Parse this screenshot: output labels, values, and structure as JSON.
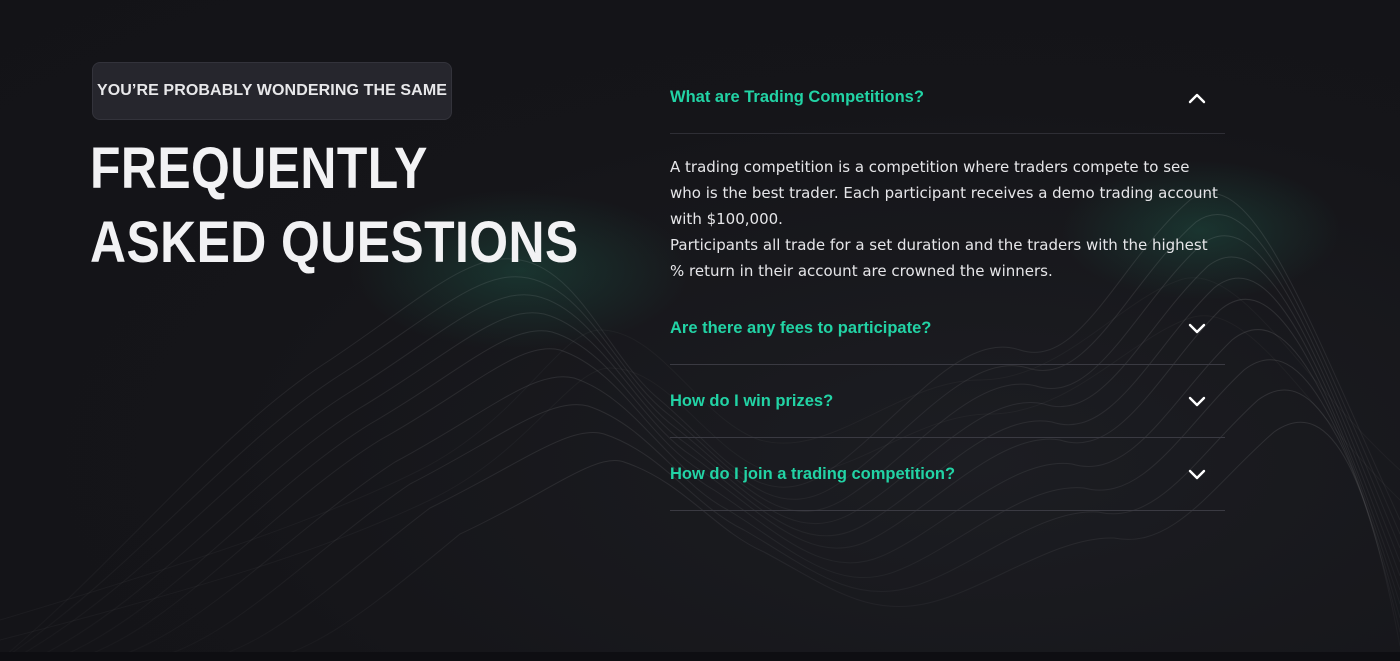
{
  "eyebrow": "YOU’RE PROBABLY WONDERING THE SAME",
  "headline": {
    "line1": "FREQUENTLY",
    "line2": "ASKED QUESTIONS"
  },
  "faq": {
    "items": [
      {
        "question": "What are Trading Competitions?",
        "expanded": true,
        "answer_lines": [
          "A trading competition is a competition where traders compete to see who is the best trader.  Each participant receives a demo trading account with $100,000.",
          "Participants all trade for a set duration and the traders with the highest % return in their account are crowned the winners."
        ]
      },
      {
        "question": "Are there any fees to participate?",
        "expanded": false
      },
      {
        "question": "How do I win prizes?",
        "expanded": false
      },
      {
        "question": "How do I join a trading competition?",
        "expanded": false
      }
    ]
  },
  "colors": {
    "accent": "#22d3a5",
    "background": "#141419",
    "badge_bg": "#26262d",
    "text": "#f2f2f4"
  },
  "icons": {
    "collapse": "chevron-up-icon",
    "expand": "chevron-down-icon"
  }
}
